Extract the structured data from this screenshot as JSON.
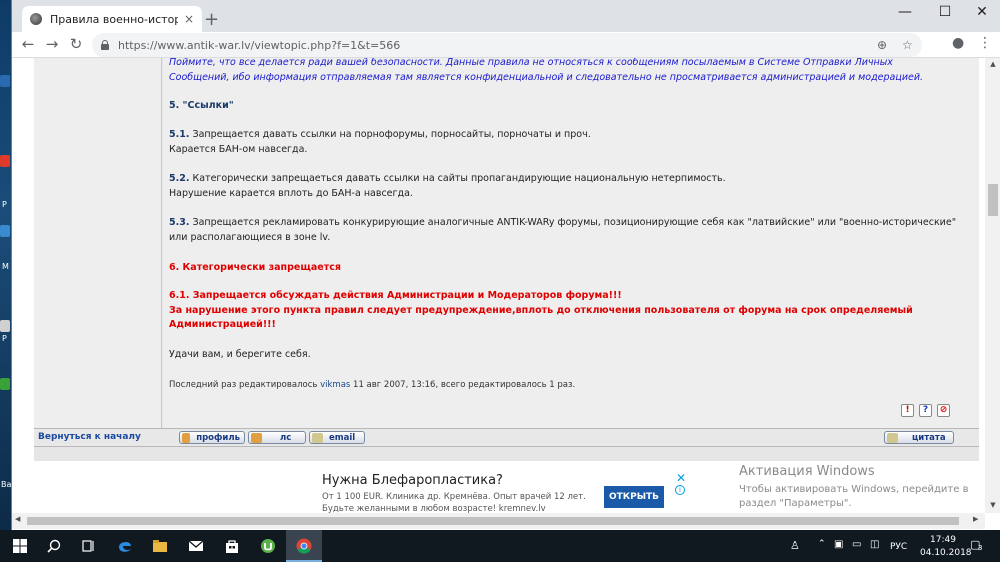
{
  "browser": {
    "tab_title": "Правила военно-исторического",
    "tab_close": "×",
    "new_tab": "+",
    "window_controls": {
      "minimize": "—",
      "maximize": "☐",
      "close": "✕"
    },
    "nav": {
      "back": "←",
      "forward": "→",
      "reload": "↻"
    },
    "url": "https://www.antik-war.lv/viewtopic.php?f=1&t=566",
    "omni_icons": {
      "zoom": "⊕",
      "star": "☆"
    },
    "toolbar_icons": {
      "profile": "●",
      "menu": "⋮"
    }
  },
  "post": {
    "intro_line1": "Поймите, что все делается ради вашей безопасности. Данные правила не относяться к сообщениям посылаемым в Системе Отправки Личных",
    "intro_line2": "Сообщений, ибо информация отправляемая там является конфиденциальной и следовательно не просматривается администрацией и модерацией.",
    "s5_heading": "5. \"Ссылки\"",
    "s5_1_num": "5.1.",
    "s5_1_text": " Запрещается давать ссылки на порнофорумы, порносайты, порночаты и проч.",
    "s5_1_line2": "Карается БАН-ом навсегда.",
    "s5_2_num": "5.2.",
    "s5_2_text": " Категорически запрещаеться давать ссылки на сайты пропагандирующие национальную нетерпимость.",
    "s5_2_line2": "Нарушение карается вплоть до БАН-а навсегда.",
    "s5_3_num": "5.3.",
    "s5_3_text": " Запрещается рекламировать конкурирующие аналогичные ANTIK-WARy форумы, позиционирующие себя как \"латвийские\" или \"военно-исторические\"",
    "s5_3_line2": "или располагающиеся в зоне lv.",
    "s6_heading": "6. Категорически запрещается",
    "s6_1_line1": "6.1. Запрещается обсуждать действия Администрации и Модераторов форума!!!",
    "s6_1_line2": "За нарушение этого пункта правил следует предупреждение,вплоть до отключения пользователя от форума на срок определяемый",
    "s6_1_line3": "Администрацией!!!",
    "closing": "Удачи вам, и берегите себя.",
    "edit_prefix": "Последний раз редактировалось ",
    "edit_author": "vikmas",
    "edit_suffix": " 11 авг 2007, 13:16, всего редактировалось 1 раз.",
    "mini_icons": [
      "!",
      "?",
      "⊘"
    ]
  },
  "buttons": {
    "back_to_top": "Вернуться к началу",
    "profile": "профиль",
    "pm": "лс",
    "email": "email",
    "quote": "цитата"
  },
  "ad": {
    "title": "Нужна Блефаропластика?",
    "line1": "От 1 100 EUR. Клиника др. Кремнёва. Опыт врачей 12 лет.",
    "line2": "Будьте желанными в любом возрасте! kremnev.lv",
    "button": "ОТКРЫТЬ",
    "close": "✕",
    "info": "i"
  },
  "activation": {
    "title": "Активация Windows",
    "text": "Чтобы активировать Windows, перейдите в раздел \"Параметры\"."
  },
  "taskbar": {
    "language": "РУС",
    "time": "17:49",
    "date": "04.10.2018",
    "notifications": "3"
  },
  "desktop_labels": [
    "Р",
    "Р",
    "М",
    "Р",
    "Ва"
  ]
}
